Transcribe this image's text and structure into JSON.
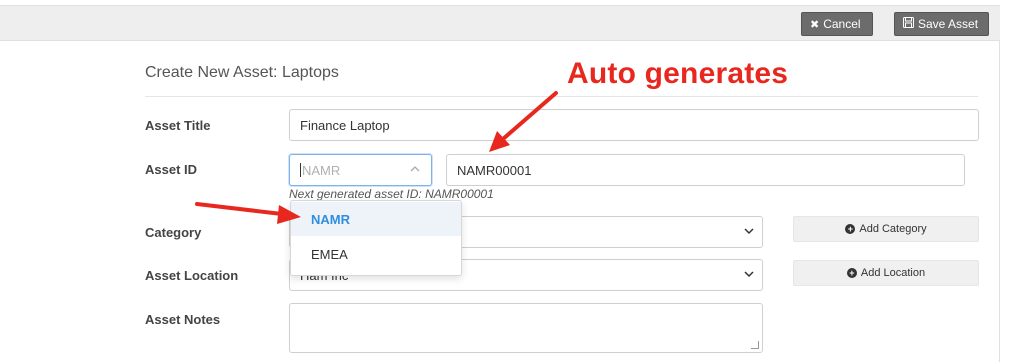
{
  "toolbar": {
    "cancel_label": "Cancel",
    "cancel_icon": "close-icon",
    "save_label": "Save Asset",
    "save_icon": "floppy-disk-icon"
  },
  "form": {
    "title": "Create New Asset: Laptops",
    "asset_title": {
      "label": "Asset Title",
      "value": "Finance Laptop"
    },
    "asset_id": {
      "label": "Asset ID",
      "prefix_placeholder": "NAMR",
      "value": "NAMR00001",
      "hint": "Next generated asset ID: NAMR00001",
      "options": [
        "NAMR",
        "EMEA"
      ],
      "highlighted_option": "NAMR"
    },
    "category": {
      "label": "Category",
      "add_label": "Add Category"
    },
    "asset_location": {
      "label": "Asset Location",
      "value": "Ham Inc",
      "add_label": "Add Location"
    },
    "asset_notes": {
      "label": "Asset Notes",
      "value": ""
    }
  },
  "annotation": {
    "text": "Auto generates",
    "color": "#e8281e"
  }
}
